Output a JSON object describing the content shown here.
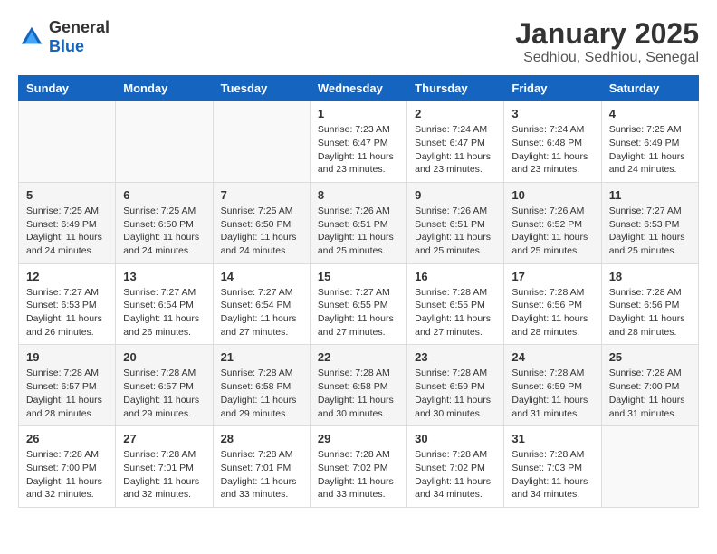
{
  "header": {
    "logo": {
      "general": "General",
      "blue": "Blue"
    },
    "title": "January 2025",
    "subtitle": "Sedhiou, Sedhiou, Senegal"
  },
  "weekdays": [
    "Sunday",
    "Monday",
    "Tuesday",
    "Wednesday",
    "Thursday",
    "Friday",
    "Saturday"
  ],
  "weeks": [
    [
      {
        "day": "",
        "sunrise": "",
        "sunset": "",
        "daylight": ""
      },
      {
        "day": "",
        "sunrise": "",
        "sunset": "",
        "daylight": ""
      },
      {
        "day": "",
        "sunrise": "",
        "sunset": "",
        "daylight": ""
      },
      {
        "day": "1",
        "sunrise": "Sunrise: 7:23 AM",
        "sunset": "Sunset: 6:47 PM",
        "daylight": "Daylight: 11 hours and 23 minutes."
      },
      {
        "day": "2",
        "sunrise": "Sunrise: 7:24 AM",
        "sunset": "Sunset: 6:47 PM",
        "daylight": "Daylight: 11 hours and 23 minutes."
      },
      {
        "day": "3",
        "sunrise": "Sunrise: 7:24 AM",
        "sunset": "Sunset: 6:48 PM",
        "daylight": "Daylight: 11 hours and 23 minutes."
      },
      {
        "day": "4",
        "sunrise": "Sunrise: 7:25 AM",
        "sunset": "Sunset: 6:49 PM",
        "daylight": "Daylight: 11 hours and 24 minutes."
      }
    ],
    [
      {
        "day": "5",
        "sunrise": "Sunrise: 7:25 AM",
        "sunset": "Sunset: 6:49 PM",
        "daylight": "Daylight: 11 hours and 24 minutes."
      },
      {
        "day": "6",
        "sunrise": "Sunrise: 7:25 AM",
        "sunset": "Sunset: 6:50 PM",
        "daylight": "Daylight: 11 hours and 24 minutes."
      },
      {
        "day": "7",
        "sunrise": "Sunrise: 7:25 AM",
        "sunset": "Sunset: 6:50 PM",
        "daylight": "Daylight: 11 hours and 24 minutes."
      },
      {
        "day": "8",
        "sunrise": "Sunrise: 7:26 AM",
        "sunset": "Sunset: 6:51 PM",
        "daylight": "Daylight: 11 hours and 25 minutes."
      },
      {
        "day": "9",
        "sunrise": "Sunrise: 7:26 AM",
        "sunset": "Sunset: 6:51 PM",
        "daylight": "Daylight: 11 hours and 25 minutes."
      },
      {
        "day": "10",
        "sunrise": "Sunrise: 7:26 AM",
        "sunset": "Sunset: 6:52 PM",
        "daylight": "Daylight: 11 hours and 25 minutes."
      },
      {
        "day": "11",
        "sunrise": "Sunrise: 7:27 AM",
        "sunset": "Sunset: 6:53 PM",
        "daylight": "Daylight: 11 hours and 25 minutes."
      }
    ],
    [
      {
        "day": "12",
        "sunrise": "Sunrise: 7:27 AM",
        "sunset": "Sunset: 6:53 PM",
        "daylight": "Daylight: 11 hours and 26 minutes."
      },
      {
        "day": "13",
        "sunrise": "Sunrise: 7:27 AM",
        "sunset": "Sunset: 6:54 PM",
        "daylight": "Daylight: 11 hours and 26 minutes."
      },
      {
        "day": "14",
        "sunrise": "Sunrise: 7:27 AM",
        "sunset": "Sunset: 6:54 PM",
        "daylight": "Daylight: 11 hours and 27 minutes."
      },
      {
        "day": "15",
        "sunrise": "Sunrise: 7:27 AM",
        "sunset": "Sunset: 6:55 PM",
        "daylight": "Daylight: 11 hours and 27 minutes."
      },
      {
        "day": "16",
        "sunrise": "Sunrise: 7:28 AM",
        "sunset": "Sunset: 6:55 PM",
        "daylight": "Daylight: 11 hours and 27 minutes."
      },
      {
        "day": "17",
        "sunrise": "Sunrise: 7:28 AM",
        "sunset": "Sunset: 6:56 PM",
        "daylight": "Daylight: 11 hours and 28 minutes."
      },
      {
        "day": "18",
        "sunrise": "Sunrise: 7:28 AM",
        "sunset": "Sunset: 6:56 PM",
        "daylight": "Daylight: 11 hours and 28 minutes."
      }
    ],
    [
      {
        "day": "19",
        "sunrise": "Sunrise: 7:28 AM",
        "sunset": "Sunset: 6:57 PM",
        "daylight": "Daylight: 11 hours and 28 minutes."
      },
      {
        "day": "20",
        "sunrise": "Sunrise: 7:28 AM",
        "sunset": "Sunset: 6:57 PM",
        "daylight": "Daylight: 11 hours and 29 minutes."
      },
      {
        "day": "21",
        "sunrise": "Sunrise: 7:28 AM",
        "sunset": "Sunset: 6:58 PM",
        "daylight": "Daylight: 11 hours and 29 minutes."
      },
      {
        "day": "22",
        "sunrise": "Sunrise: 7:28 AM",
        "sunset": "Sunset: 6:58 PM",
        "daylight": "Daylight: 11 hours and 30 minutes."
      },
      {
        "day": "23",
        "sunrise": "Sunrise: 7:28 AM",
        "sunset": "Sunset: 6:59 PM",
        "daylight": "Daylight: 11 hours and 30 minutes."
      },
      {
        "day": "24",
        "sunrise": "Sunrise: 7:28 AM",
        "sunset": "Sunset: 6:59 PM",
        "daylight": "Daylight: 11 hours and 31 minutes."
      },
      {
        "day": "25",
        "sunrise": "Sunrise: 7:28 AM",
        "sunset": "Sunset: 7:00 PM",
        "daylight": "Daylight: 11 hours and 31 minutes."
      }
    ],
    [
      {
        "day": "26",
        "sunrise": "Sunrise: 7:28 AM",
        "sunset": "Sunset: 7:00 PM",
        "daylight": "Daylight: 11 hours and 32 minutes."
      },
      {
        "day": "27",
        "sunrise": "Sunrise: 7:28 AM",
        "sunset": "Sunset: 7:01 PM",
        "daylight": "Daylight: 11 hours and 32 minutes."
      },
      {
        "day": "28",
        "sunrise": "Sunrise: 7:28 AM",
        "sunset": "Sunset: 7:01 PM",
        "daylight": "Daylight: 11 hours and 33 minutes."
      },
      {
        "day": "29",
        "sunrise": "Sunrise: 7:28 AM",
        "sunset": "Sunset: 7:02 PM",
        "daylight": "Daylight: 11 hours and 33 minutes."
      },
      {
        "day": "30",
        "sunrise": "Sunrise: 7:28 AM",
        "sunset": "Sunset: 7:02 PM",
        "daylight": "Daylight: 11 hours and 34 minutes."
      },
      {
        "day": "31",
        "sunrise": "Sunrise: 7:28 AM",
        "sunset": "Sunset: 7:03 PM",
        "daylight": "Daylight: 11 hours and 34 minutes."
      },
      {
        "day": "",
        "sunrise": "",
        "sunset": "",
        "daylight": ""
      }
    ]
  ]
}
